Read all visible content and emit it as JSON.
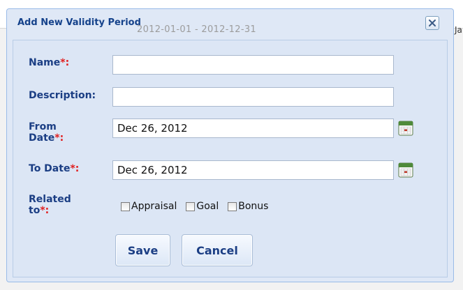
{
  "background": {
    "ghost_text": "2012-01-01 - 2012-12-31",
    "edge_text": "Ja"
  },
  "dialog": {
    "title": "Add New Validity Period",
    "close_icon": "close-icon"
  },
  "form": {
    "name": {
      "label": "Name",
      "required_mark": "*:",
      "value": ""
    },
    "description": {
      "label": "Description:",
      "value": ""
    },
    "from_date": {
      "label_line1": "From",
      "label_line2": "Date",
      "required_mark": "*:",
      "value": "Dec 26, 2012",
      "icon": "calendar-icon"
    },
    "to_date": {
      "label": "To Date",
      "required_mark": "*:",
      "value": "Dec 26, 2012",
      "icon": "calendar-icon"
    },
    "related_to": {
      "label_line1": "Related",
      "label_line2": "to",
      "required_mark": "*:",
      "options": [
        {
          "label": "Appraisal",
          "checked": false
        },
        {
          "label": "Goal",
          "checked": false
        },
        {
          "label": "Bonus",
          "checked": false
        }
      ]
    }
  },
  "buttons": {
    "save": "Save",
    "cancel": "Cancel"
  },
  "colors": {
    "label": "#1b3e84",
    "required": "#e02020",
    "dialog_bg": "#dfe8f6",
    "border": "#99bbe8"
  }
}
